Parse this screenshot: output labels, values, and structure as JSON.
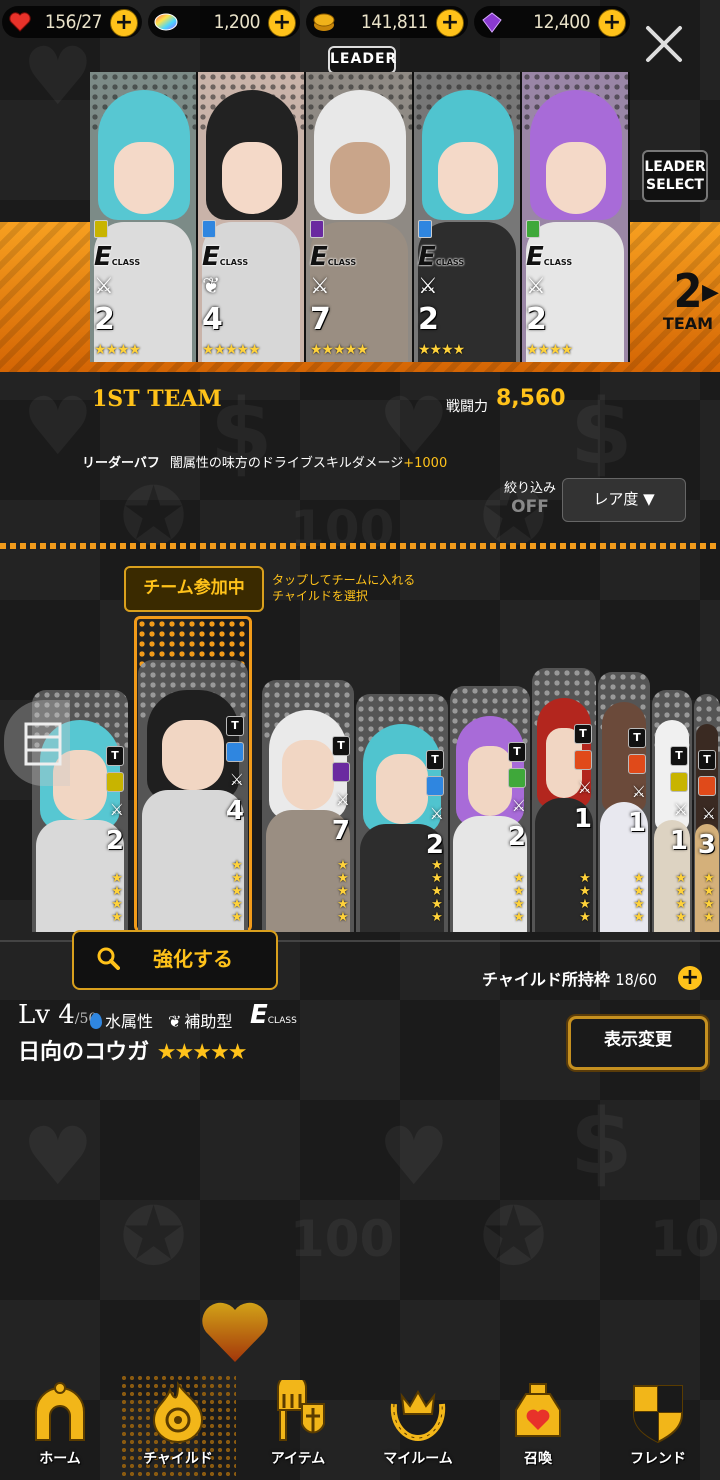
{
  "resources": {
    "stamina": {
      "value": "156",
      "max": "/27",
      "icon": "heart-icon",
      "color": "#e8322a"
    },
    "gems": {
      "value": "1,200",
      "icon": "rainbow-gem-icon"
    },
    "gold": {
      "value": "141,811",
      "icon": "gold-coin-icon",
      "color": "#f0b21a"
    },
    "crystals": {
      "value": "12,400",
      "icon": "purple-crystal-icon",
      "color": "#8a3ad0"
    }
  },
  "team": {
    "leader_tag": "LEADER",
    "leader_select": [
      "LEADER",
      "SELECT"
    ],
    "next_team_num": "2",
    "next_team_label": "TEAM",
    "label": "1ST TEAM",
    "power_label": "戦闘力",
    "power_value": "8,560",
    "class_letter": "E",
    "class_text": "CLASS",
    "members": [
      {
        "count": "2",
        "stars": "★★★★",
        "hair": "#57c7d2",
        "element": "light"
      },
      {
        "count": "4",
        "stars": "★★★★★",
        "hair": "#222222",
        "element": "water"
      },
      {
        "count": "7",
        "stars": "★★★★★",
        "hair": "#e8e8e8",
        "element": "dark"
      },
      {
        "count": "2",
        "stars": "★★★★",
        "hair": "#50c4cf",
        "element": "water"
      },
      {
        "count": "2",
        "stars": "★★★★",
        "hair": "#a86bd8",
        "element": "nature"
      }
    ]
  },
  "buff": {
    "label": "リーダーバフ",
    "text": "闇属性の味方のドライブスキルダメージ",
    "bonus": "+1000"
  },
  "filter": {
    "label": "絞り込み",
    "state": "OFF",
    "sort_label": "レア度 ▼"
  },
  "roster": {
    "joined_label": "チーム参加中",
    "hint_line1": "タップしてチームに入れる",
    "hint_line2": "チャイルドを選択",
    "t_badge": "T",
    "cards": [
      {
        "count": "2",
        "stars": 4,
        "hair": "#57c7d2",
        "body": "#d9d9d9"
      },
      {
        "count": "4",
        "stars": 5,
        "hair": "#1f1f1f",
        "body": "#d7d7d7"
      },
      {
        "count": "7",
        "stars": 5,
        "hair": "#eaeaea",
        "body": "#9a8e82"
      },
      {
        "count": "2",
        "stars": 5,
        "hair": "#50c4cf",
        "body": "#2d2d2d"
      },
      {
        "count": "2",
        "stars": 4,
        "hair": "#a86bd8",
        "body": "#e6e6e6"
      },
      {
        "count": "1",
        "stars": 4,
        "hair": "#b3261e",
        "body": "#2a2a2a"
      },
      {
        "count": "1",
        "stars": 4,
        "hair": "#6b4a3a",
        "body": "#e8e8ef"
      },
      {
        "count": "1",
        "stars": 4,
        "hair": "#f0f0f0",
        "body": "#ddd3c2"
      },
      {
        "count": "3",
        "stars": 4,
        "hair": "#3a2a22",
        "body": "#d4b07a"
      }
    ]
  },
  "enhance_label": "強化する",
  "slots": {
    "label": "チャイルド所持枠",
    "value": "18/60"
  },
  "selected": {
    "level_prefix": "Lv",
    "level": "4",
    "level_max": "/50",
    "attribute": "水属性",
    "type": "補助型",
    "class_letter": "E",
    "class_text": "CLASS",
    "name": "日向のコウガ",
    "stars": "★★★★★"
  },
  "display_button": "表示変更",
  "nav": [
    {
      "label": "ホーム",
      "icon": "home-arch-icon"
    },
    {
      "label": "チャイルド",
      "icon": "child-flame-icon",
      "active": true
    },
    {
      "label": "アイテム",
      "icon": "item-knight-icon"
    },
    {
      "label": "マイルーム",
      "icon": "myroom-crown-icon"
    },
    {
      "label": "召喚",
      "icon": "summon-potion-icon"
    },
    {
      "label": "フレンド",
      "icon": "friend-shield-icon"
    }
  ]
}
